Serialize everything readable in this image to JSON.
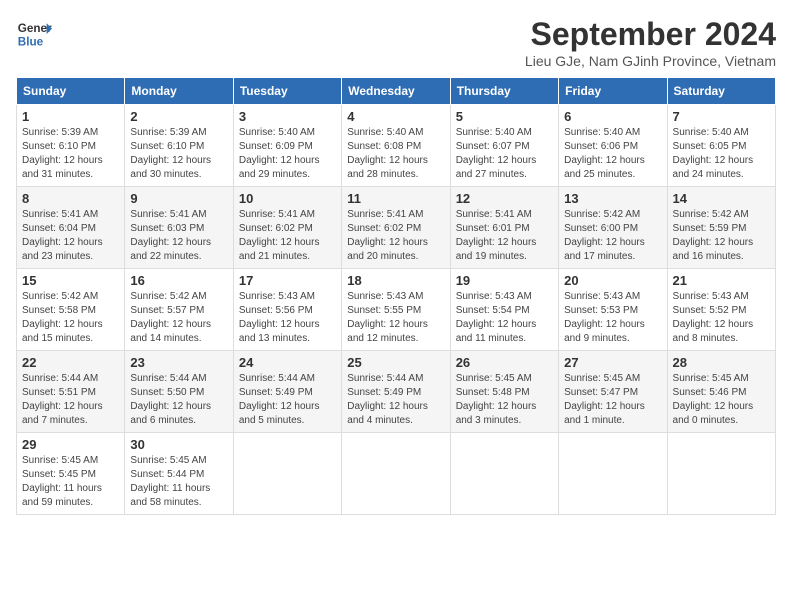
{
  "header": {
    "logo_line1": "General",
    "logo_line2": "Blue",
    "month": "September 2024",
    "location": "Lieu GJe, Nam GJinh Province, Vietnam"
  },
  "weekdays": [
    "Sunday",
    "Monday",
    "Tuesday",
    "Wednesday",
    "Thursday",
    "Friday",
    "Saturday"
  ],
  "weeks": [
    [
      {
        "day": "1",
        "info": "Sunrise: 5:39 AM\nSunset: 6:10 PM\nDaylight: 12 hours\nand 31 minutes."
      },
      {
        "day": "2",
        "info": "Sunrise: 5:39 AM\nSunset: 6:10 PM\nDaylight: 12 hours\nand 30 minutes."
      },
      {
        "day": "3",
        "info": "Sunrise: 5:40 AM\nSunset: 6:09 PM\nDaylight: 12 hours\nand 29 minutes."
      },
      {
        "day": "4",
        "info": "Sunrise: 5:40 AM\nSunset: 6:08 PM\nDaylight: 12 hours\nand 28 minutes."
      },
      {
        "day": "5",
        "info": "Sunrise: 5:40 AM\nSunset: 6:07 PM\nDaylight: 12 hours\nand 27 minutes."
      },
      {
        "day": "6",
        "info": "Sunrise: 5:40 AM\nSunset: 6:06 PM\nDaylight: 12 hours\nand 25 minutes."
      },
      {
        "day": "7",
        "info": "Sunrise: 5:40 AM\nSunset: 6:05 PM\nDaylight: 12 hours\nand 24 minutes."
      }
    ],
    [
      {
        "day": "8",
        "info": "Sunrise: 5:41 AM\nSunset: 6:04 PM\nDaylight: 12 hours\nand 23 minutes."
      },
      {
        "day": "9",
        "info": "Sunrise: 5:41 AM\nSunset: 6:03 PM\nDaylight: 12 hours\nand 22 minutes."
      },
      {
        "day": "10",
        "info": "Sunrise: 5:41 AM\nSunset: 6:02 PM\nDaylight: 12 hours\nand 21 minutes."
      },
      {
        "day": "11",
        "info": "Sunrise: 5:41 AM\nSunset: 6:02 PM\nDaylight: 12 hours\nand 20 minutes."
      },
      {
        "day": "12",
        "info": "Sunrise: 5:41 AM\nSunset: 6:01 PM\nDaylight: 12 hours\nand 19 minutes."
      },
      {
        "day": "13",
        "info": "Sunrise: 5:42 AM\nSunset: 6:00 PM\nDaylight: 12 hours\nand 17 minutes."
      },
      {
        "day": "14",
        "info": "Sunrise: 5:42 AM\nSunset: 5:59 PM\nDaylight: 12 hours\nand 16 minutes."
      }
    ],
    [
      {
        "day": "15",
        "info": "Sunrise: 5:42 AM\nSunset: 5:58 PM\nDaylight: 12 hours\nand 15 minutes."
      },
      {
        "day": "16",
        "info": "Sunrise: 5:42 AM\nSunset: 5:57 PM\nDaylight: 12 hours\nand 14 minutes."
      },
      {
        "day": "17",
        "info": "Sunrise: 5:43 AM\nSunset: 5:56 PM\nDaylight: 12 hours\nand 13 minutes."
      },
      {
        "day": "18",
        "info": "Sunrise: 5:43 AM\nSunset: 5:55 PM\nDaylight: 12 hours\nand 12 minutes."
      },
      {
        "day": "19",
        "info": "Sunrise: 5:43 AM\nSunset: 5:54 PM\nDaylight: 12 hours\nand 11 minutes."
      },
      {
        "day": "20",
        "info": "Sunrise: 5:43 AM\nSunset: 5:53 PM\nDaylight: 12 hours\nand 9 minutes."
      },
      {
        "day": "21",
        "info": "Sunrise: 5:43 AM\nSunset: 5:52 PM\nDaylight: 12 hours\nand 8 minutes."
      }
    ],
    [
      {
        "day": "22",
        "info": "Sunrise: 5:44 AM\nSunset: 5:51 PM\nDaylight: 12 hours\nand 7 minutes."
      },
      {
        "day": "23",
        "info": "Sunrise: 5:44 AM\nSunset: 5:50 PM\nDaylight: 12 hours\nand 6 minutes."
      },
      {
        "day": "24",
        "info": "Sunrise: 5:44 AM\nSunset: 5:49 PM\nDaylight: 12 hours\nand 5 minutes."
      },
      {
        "day": "25",
        "info": "Sunrise: 5:44 AM\nSunset: 5:49 PM\nDaylight: 12 hours\nand 4 minutes."
      },
      {
        "day": "26",
        "info": "Sunrise: 5:45 AM\nSunset: 5:48 PM\nDaylight: 12 hours\nand 3 minutes."
      },
      {
        "day": "27",
        "info": "Sunrise: 5:45 AM\nSunset: 5:47 PM\nDaylight: 12 hours\nand 1 minute."
      },
      {
        "day": "28",
        "info": "Sunrise: 5:45 AM\nSunset: 5:46 PM\nDaylight: 12 hours\nand 0 minutes."
      }
    ],
    [
      {
        "day": "29",
        "info": "Sunrise: 5:45 AM\nSunset: 5:45 PM\nDaylight: 11 hours\nand 59 minutes."
      },
      {
        "day": "30",
        "info": "Sunrise: 5:45 AM\nSunset: 5:44 PM\nDaylight: 11 hours\nand 58 minutes."
      },
      {
        "day": "",
        "info": ""
      },
      {
        "day": "",
        "info": ""
      },
      {
        "day": "",
        "info": ""
      },
      {
        "day": "",
        "info": ""
      },
      {
        "day": "",
        "info": ""
      }
    ]
  ]
}
